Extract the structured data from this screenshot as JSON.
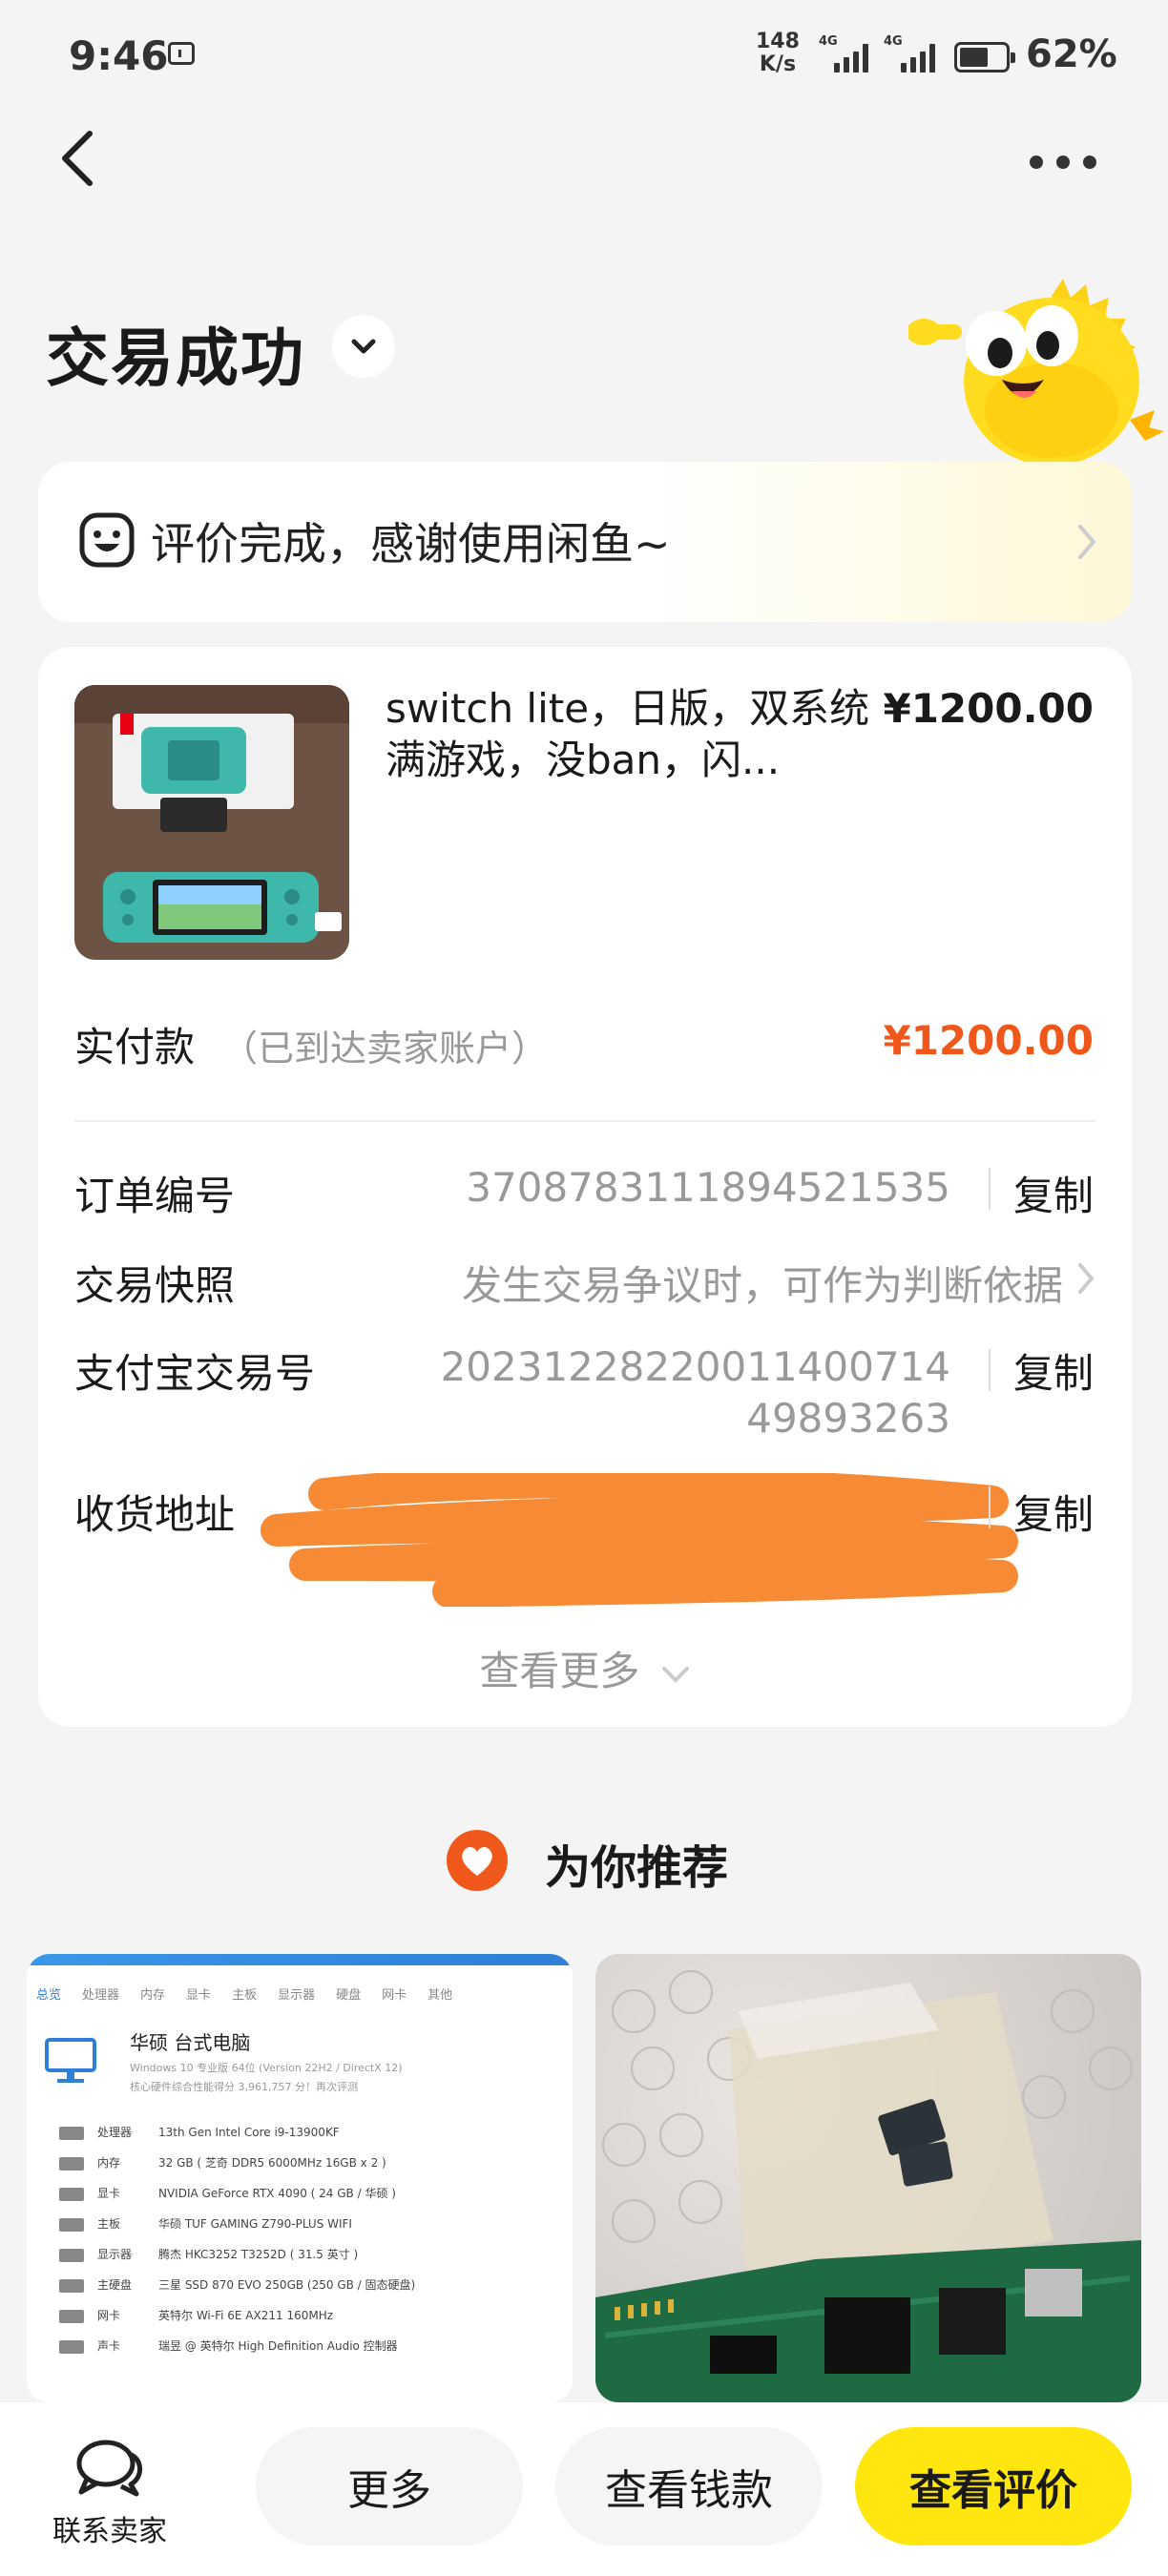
{
  "status_bar": {
    "time": "9:46",
    "network_speed_value": "148",
    "network_speed_unit": "K/s",
    "signal_1": "4G",
    "signal_2": "4G",
    "battery": "62%",
    "battery_level": 0.62
  },
  "header": {
    "title": "交易成功"
  },
  "review_banner": {
    "text": "评价完成，感谢使用闲鱼~"
  },
  "order": {
    "product_title": "switch lite，日版，双系统满游戏，没ban，闪...",
    "product_price": "¥1200.00",
    "paid_label": "实付款",
    "paid_note": "（已到达卖家账户）",
    "paid_amount": "¥1200.00",
    "rows": [
      {
        "label": "订单编号",
        "value": "3708783111894521535",
        "action": "复制"
      },
      {
        "label": "交易快照",
        "value": "发生交易争议时，可作为判断依据"
      },
      {
        "label": "支付宝交易号",
        "value_line1": "20231228220011400714",
        "value_line2": "49893263",
        "action": "复制"
      },
      {
        "label": "收货地址",
        "action": "复制"
      }
    ],
    "view_more": "查看更多"
  },
  "recommend": {
    "heading": "为你推荐",
    "card1": {
      "tabs": [
        "总览",
        "处理器",
        "内存",
        "显卡",
        "主板",
        "显示器",
        "硬盘",
        "网卡",
        "其他"
      ],
      "title": "华硕 台式电脑",
      "subtitle": "Windows 10 专业版 64位 (Version 22H2 / DirectX 12)",
      "score": "核心硬件综合性能得分 3,961,757 分！再次评测",
      "specs": [
        {
          "k": "处理器",
          "v": "13th Gen Intel Core i9-13900KF"
        },
        {
          "k": "内存",
          "v": "32 GB ( 芝奇 DDR5 6000MHz 16GB x 2 )"
        },
        {
          "k": "显卡",
          "v": "NVIDIA GeForce RTX 4090 ( 24 GB / 华硕 )"
        },
        {
          "k": "主板",
          "v": "华硕 TUF GAMING Z790-PLUS WIFI"
        },
        {
          "k": "显示器",
          "v": "腾杰 HKC3252 T3252D ( 31.5 英寸 )"
        },
        {
          "k": "主硬盘",
          "v": "三星 SSD 870 EVO 250GB (250 GB / 固态硬盘)"
        },
        {
          "k": "网卡",
          "v": "英特尔 Wi-Fi 6E AX211 160MHz"
        },
        {
          "k": "声卡",
          "v": "瑞昱 @ 英特尔 High Definition Audio 控制器"
        }
      ]
    }
  },
  "bottom_bar": {
    "contact_label": "联系卖家",
    "more_label": "更多",
    "funds_label": "查看钱款",
    "review_label": "查看评价"
  },
  "colors": {
    "accent_orange": "#f0571b",
    "brand_yellow": "#ffe60f",
    "redaction": "#f78a35"
  }
}
